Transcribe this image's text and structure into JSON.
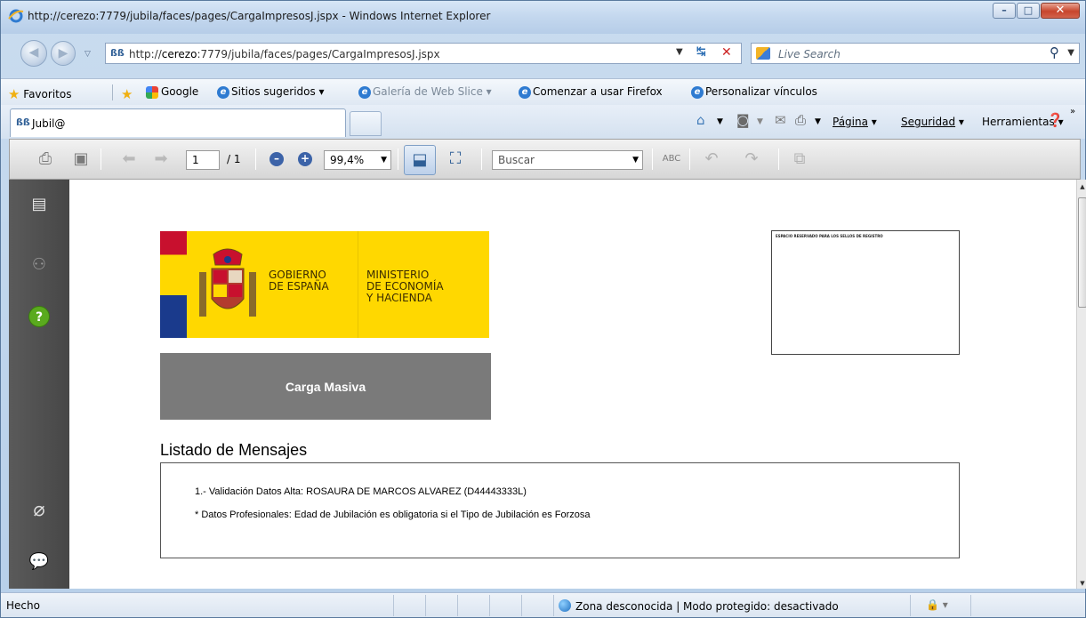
{
  "window": {
    "title": "http://cerezo:7779/jubila/faces/pages/CargaImpresosJ.jspx - Windows Internet Explorer"
  },
  "address_bar": {
    "url_prefix": "http://",
    "url_host": "cerezo",
    "url_rest": ":7779/jubila/faces/pages/CargaImpresosJ.jspx",
    "search_placeholder": "Live Search"
  },
  "favorites_bar": {
    "favorites_label": "Favoritos",
    "links": [
      "Google",
      "Sitios sugeridos ▾",
      "Galería de Web Slice ▾",
      "Comenzar a usar Firefox",
      "Personalizar vínculos"
    ]
  },
  "tabs": {
    "active_tab_label": "Jubil@"
  },
  "command_bar": {
    "page_label": "Página",
    "security_label": "Seguridad",
    "tools_label": "Herramientas"
  },
  "pdf_toolbar": {
    "current_page": "1",
    "total_pages": "/ 1",
    "zoom": "99,4%",
    "search_placeholder": "Buscar"
  },
  "document": {
    "logo_text_left": [
      "GOBIERNO",
      "DE ESPAÑA"
    ],
    "logo_text_right": [
      "MINISTERIO",
      "DE ECONOMÍA",
      "Y HACIENDA"
    ],
    "stamp_box_label": "ESPACIO RESERVADO PARA LOS SELLOS DE REGISTRO",
    "banner_label": "Carga Masiva",
    "messages_title": "Listado de Mensajes",
    "messages": [
      "1.- Validación Datos Alta: ROSAURA DE MARCOS ALVAREZ (D44443333L)",
      "* Datos Profesionales: Edad de Jubilación es obligatoria si el Tipo de Jubilación es Forzosa"
    ]
  },
  "status_bar": {
    "status_text": "Hecho",
    "zone_text": "Zona desconocida | Modo protegido: desactivado"
  },
  "colors": {
    "logo_yellow": "#ffd800",
    "banner_gray": "#7a7a7a",
    "rail_dark": "#4f4f4f",
    "close_red": "#c7452c"
  }
}
